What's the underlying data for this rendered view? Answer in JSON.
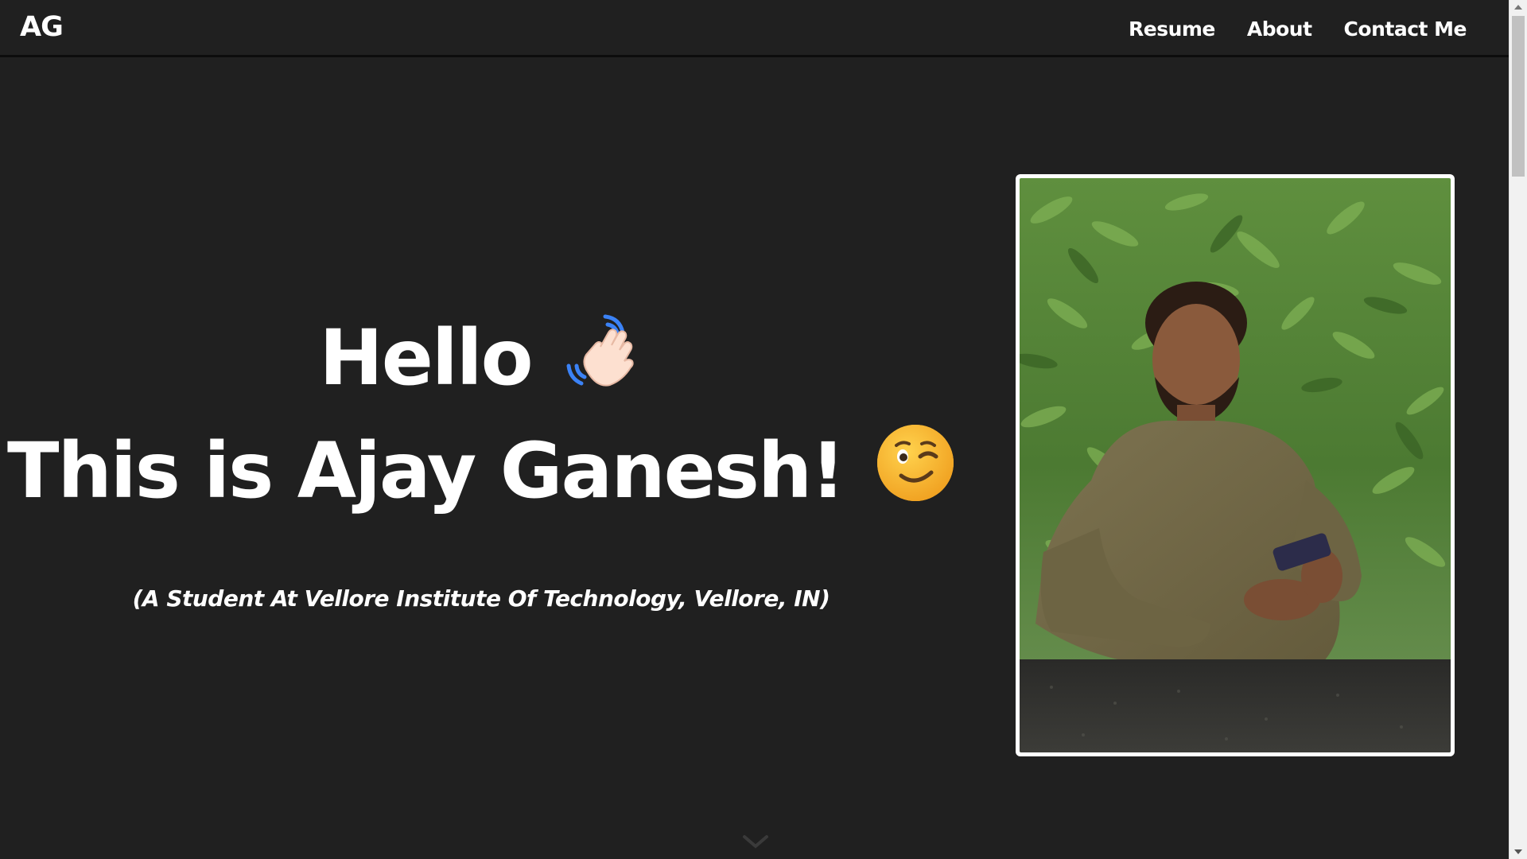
{
  "navbar": {
    "logo": "AG",
    "links": [
      {
        "label": "Resume"
      },
      {
        "label": "About"
      },
      {
        "label": "Contact Me"
      }
    ]
  },
  "hero": {
    "greeting": "Hello",
    "greeting_emoji": "waving-hand-icon",
    "name_line": "This is Ajay Ganesh!",
    "name_emoji": "winking-face-icon",
    "subtitle": "(A Student At Vellore Institute Of Technology, Vellore, IN)"
  },
  "photo": {
    "subject": "portrait-photo"
  },
  "colors": {
    "background": "#202020",
    "text": "#ffffff",
    "frame": "#ffffff"
  }
}
